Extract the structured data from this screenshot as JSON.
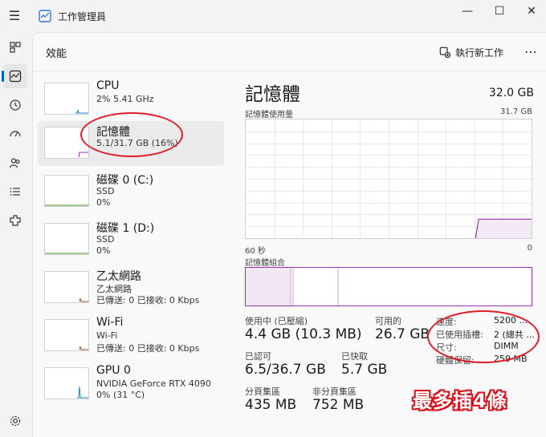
{
  "window": {
    "title": "工作管理員",
    "minimize_glyph": "—",
    "maximize_glyph": "☐",
    "close_glyph": "✕"
  },
  "nav": {
    "items": [
      {
        "icon": "processes-icon"
      },
      {
        "icon": "performance-icon",
        "active": true
      },
      {
        "icon": "app-history-icon"
      },
      {
        "icon": "startup-apps-icon"
      },
      {
        "icon": "users-icon"
      },
      {
        "icon": "details-icon"
      },
      {
        "icon": "services-icon"
      },
      {
        "icon": "settings-icon"
      }
    ]
  },
  "header": {
    "title": "效能",
    "run_task_label": "執行新工作",
    "more_glyph": "⋯"
  },
  "perf_list": [
    {
      "name": "CPU",
      "line1": "2%  5.41 GHz",
      "line2": "",
      "line3": "",
      "color": "#1a86c8"
    },
    {
      "name": "記憶體",
      "line1": "5.1/31.7 GB (16%)",
      "line2": "",
      "line3": "",
      "color": "#8e2ea6",
      "selected": true
    },
    {
      "name": "磁碟 0 (C:)",
      "line1": "SSD",
      "line2": "0%",
      "line3": "",
      "color": "#4a9a1e"
    },
    {
      "name": "磁碟 1 (D:)",
      "line1": "SSD",
      "line2": "0%",
      "line3": "",
      "color": "#4a9a1e"
    },
    {
      "name": "乙太網路",
      "line1": "乙太網路",
      "line2": "已傳送: 0 已接收: 0 Kbps",
      "line3": "",
      "color": "#a0522d"
    },
    {
      "name": "Wi-Fi",
      "line1": "Wi-Fi",
      "line2": "已傳送: 0 已接收: 0 Kbps",
      "line3": "",
      "color": "#a0522d"
    },
    {
      "name": "GPU 0",
      "line1": "NVIDIA GeForce RTX 4090",
      "line2": "0% (31 °C)",
      "line3": "",
      "color": "#1a86c8"
    }
  ],
  "detail": {
    "title": "記憶體",
    "total": "32.0 GB",
    "usage_label": "記憶體使用量",
    "usage_max": "31.7 GB",
    "time_left": "60 秒",
    "time_right": "0",
    "composition_label": "記憶體組合",
    "usage_fraction": 0.16,
    "accent_color": "#9b2fb4",
    "stats": {
      "in_use_label": "使用中 (已壓縮)",
      "in_use_value": "4.4 GB (10.3 MB)",
      "available_label": "可用的",
      "available_value": "26.7 GB",
      "committed_label": "已認可",
      "committed_value": "6.5/36.7 GB",
      "cached_label": "已快取",
      "cached_value": "5.7 GB",
      "paged_label": "分頁集區",
      "paged_value": "435 MB",
      "nonpaged_label": "非分頁集區",
      "nonpaged_value": "752 MB"
    },
    "props": [
      {
        "label": "速度:",
        "value": "5200 ..."
      },
      {
        "label": "已使用插槽:",
        "value": "2 (總共 ..."
      },
      {
        "label": "尺寸:",
        "value": "DIMM"
      },
      {
        "label": "硬體保留:",
        "value": "259 MB"
      }
    ]
  },
  "annotation": {
    "text": "最多插4條",
    "color": "#e01c2a"
  }
}
